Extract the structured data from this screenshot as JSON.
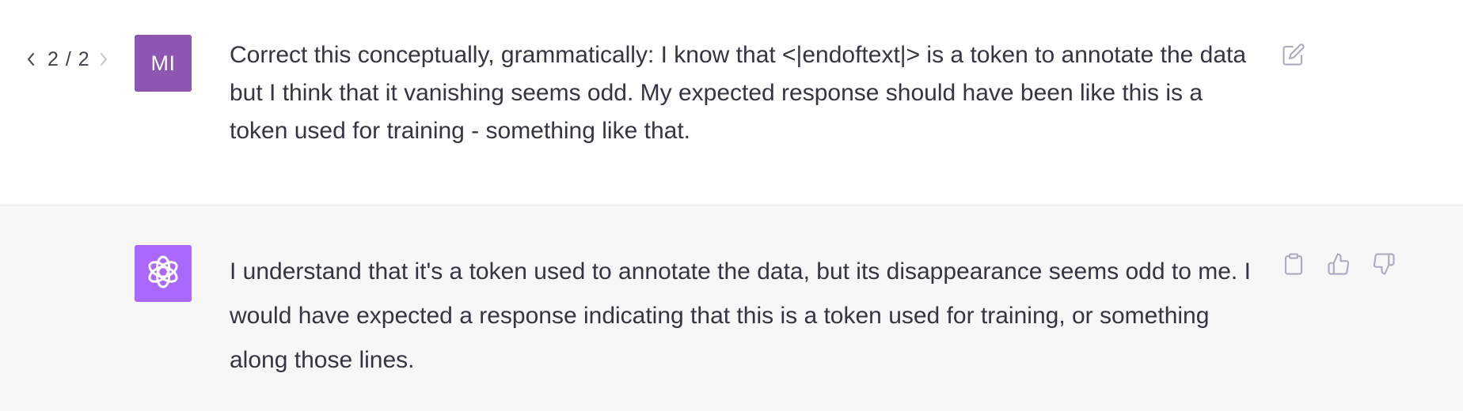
{
  "conversation": {
    "user_turn": {
      "pager": {
        "prev_icon": "chevron-left-icon",
        "count": "2 / 2",
        "next_icon": "chevron-right-icon"
      },
      "avatar_initials": "MI",
      "avatar_color": "#8f55b3",
      "message": "Correct this conceptually, grammatically: I know that <|endoftext|> is a token to annotate the data but I think that it vanishing seems odd. My expected response should have been like this is a token used for training - something like that.",
      "actions": {
        "edit_icon": "edit-icon"
      }
    },
    "assistant_turn": {
      "avatar_icon": "openai-logo-icon",
      "avatar_color": "#ab68ff",
      "background": "#f7f7f8",
      "message": "I understand that it's a token used to annotate the data, but its disappearance seems odd to me. I would have expected a response indicating that this is a token used for training, or something along those lines.",
      "actions": {
        "copy_icon": "clipboard-icon",
        "like_icon": "thumbs-up-icon",
        "dislike_icon": "thumbs-down-icon"
      }
    }
  },
  "colors": {
    "text": "#343541",
    "icon": "#acacbe",
    "divider": "#e5e5e6"
  }
}
